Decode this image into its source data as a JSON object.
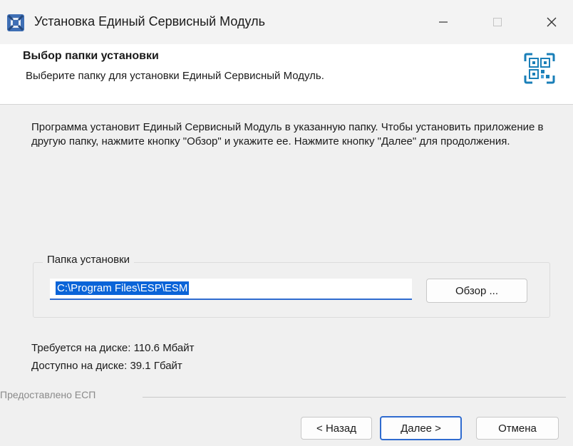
{
  "window": {
    "title": "Установка Единый Сервисный Модуль",
    "app_icon": "installer-icon",
    "controls": [
      "minimize-icon",
      "maximize-icon",
      "close-icon"
    ]
  },
  "header": {
    "title": "Выбор папки установки",
    "subtitle": "Выберите папку для установки Единый Сервисный Модуль.",
    "logo": "qr-logo-icon"
  },
  "body": {
    "description": "Программа установит Единый Сервисный Модуль в указанную папку. Чтобы установить приложение в другую папку, нажмите кнопку \"Обзор\" и укажите ее. Нажмите кнопку \"Далее\" для продолжения."
  },
  "install_folder": {
    "label": "Папка установки",
    "value": "C:\\Program Files\\ESP\\ESM",
    "browse_label": "Обзор ..."
  },
  "disk": {
    "required": "Требуется на диске: 110.6 Мбайт",
    "available": "Доступно на диске: 39.1 Гбайт"
  },
  "footer": {
    "provided_by": "Предоставлено ЕСП",
    "back_label": "< Назад",
    "next_label": "Далее >",
    "cancel_label": "Отмена"
  },
  "colors": {
    "accent": "#2f6bcf",
    "selection": "#0a64d8",
    "logo": "#1a7fb8"
  }
}
